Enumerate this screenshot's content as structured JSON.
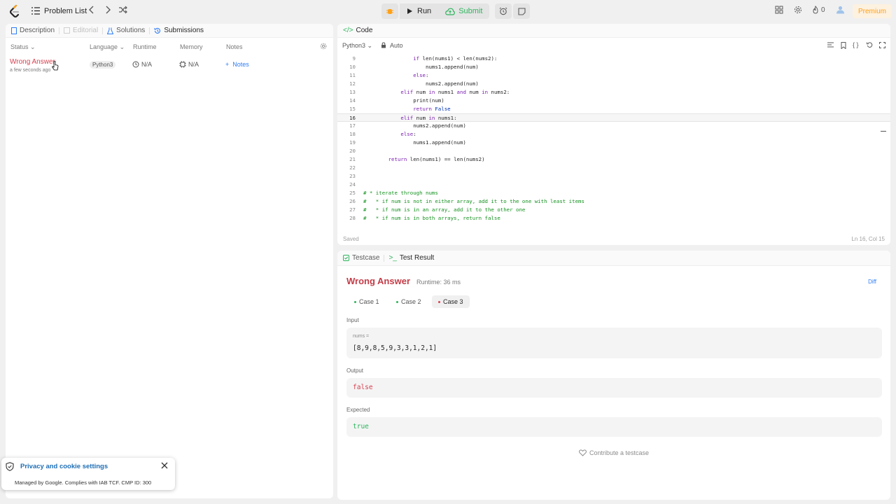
{
  "topbar": {
    "problem_list": "Problem List",
    "run": "Run",
    "submit": "Submit",
    "streak_count": "0",
    "premium": "Premium"
  },
  "left": {
    "tabs": [
      "Description",
      "Editorial",
      "Solutions",
      "Submissions"
    ],
    "columns": [
      "Status",
      "Language",
      "Runtime",
      "Memory",
      "Notes"
    ],
    "row": {
      "status": "Wrong Answer",
      "time": "a few seconds ago",
      "language": "Python3",
      "runtime": "N/A",
      "memory": "N/A",
      "notes": "Notes"
    }
  },
  "code": {
    "tab": "Code",
    "language": "Python3",
    "mode": "Auto",
    "saved": "Saved",
    "cursor_pos": "Ln 16, Col 15",
    "active_line": 16,
    "lines": [
      {
        "n": "9",
        "t": "                if len(nums1) < len(nums2):"
      },
      {
        "n": "10",
        "t": "                    nums1.append(num)"
      },
      {
        "n": "11",
        "t": "                else:"
      },
      {
        "n": "12",
        "t": "                    nums2.append(num)"
      },
      {
        "n": "13",
        "t": "            elif num in nums1 and num in nums2:"
      },
      {
        "n": "14",
        "t": "                print(num)"
      },
      {
        "n": "15",
        "t": "                return False"
      },
      {
        "n": "16",
        "t": "            elif num in nums1:"
      },
      {
        "n": "17",
        "t": "                nums2.append(num)"
      },
      {
        "n": "18",
        "t": "            else:"
      },
      {
        "n": "19",
        "t": "                nums1.append(num)"
      },
      {
        "n": "20",
        "t": ""
      },
      {
        "n": "21",
        "t": "        return len(nums1) == len(nums2)"
      },
      {
        "n": "22",
        "t": ""
      },
      {
        "n": "23",
        "t": ""
      },
      {
        "n": "24",
        "t": ""
      },
      {
        "n": "25",
        "t": "# * iterate through nums"
      },
      {
        "n": "26",
        "t": "#   * if num is not in either array, add it to the one with least items"
      },
      {
        "n": "27",
        "t": "#   * if num is in an array, add it to the other one"
      },
      {
        "n": "28",
        "t": "#   * if num is in both arrays, return false"
      }
    ]
  },
  "result": {
    "tabs": [
      "Testcase",
      "Test Result"
    ],
    "title": "Wrong Answer",
    "runtime": "Runtime: 36 ms",
    "diff": "Diff",
    "cases": [
      "Case 1",
      "Case 2",
      "Case 3"
    ],
    "input_label": "Input",
    "var_name": "nums =",
    "input_value": "[8,9,8,5,9,3,3,1,2,1]",
    "output_label": "Output",
    "output_value": "false",
    "expected_label": "Expected",
    "expected_value": "true",
    "contribute": "Contribute a testcase"
  },
  "cookie": {
    "title": "Privacy and cookie settings",
    "subtitle": "Managed by Google. Complies with IAB TCF. CMP ID: 300"
  },
  "colors": {
    "wrong": "#c33c47",
    "accept": "#2db55d",
    "link": "#2f7df6",
    "brand": "#ffa116"
  }
}
